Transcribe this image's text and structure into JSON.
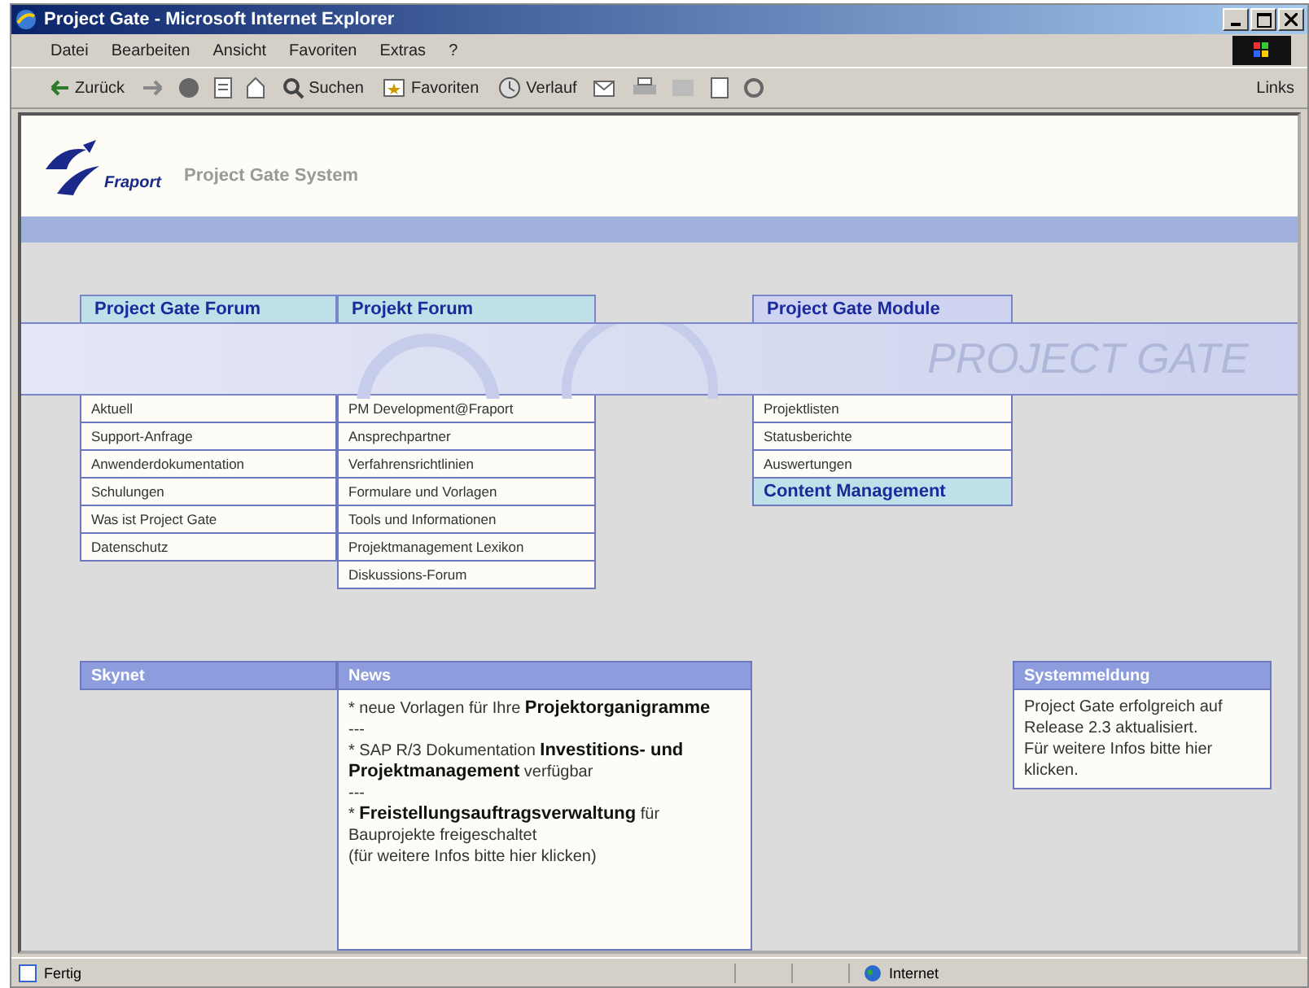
{
  "window": {
    "title": "Project Gate - Microsoft Internet Explorer"
  },
  "menu": [
    "Datei",
    "Bearbeiten",
    "Ansicht",
    "Favoriten",
    "Extras",
    "?"
  ],
  "toolbar": {
    "back": "Zurück",
    "search": "Suchen",
    "favorites": "Favoriten",
    "history": "Verlauf",
    "links": "Links"
  },
  "header": {
    "logo": "Fraport",
    "title": "Project Gate System"
  },
  "banner": "PROJECT GATE",
  "columns": [
    {
      "title": "Project Gate Forum",
      "items": [
        {
          "label": "Aktuell",
          "selected": false
        },
        {
          "label": "Support-Anfrage",
          "selected": false
        },
        {
          "label": "Anwenderdokumentation",
          "selected": false
        },
        {
          "label": "Schulungen",
          "selected": false
        },
        {
          "label": "Was ist Project Gate",
          "selected": false
        },
        {
          "label": "Datenschutz",
          "selected": false
        }
      ]
    },
    {
      "title": "Projekt Forum",
      "items": [
        {
          "label": "PM Development@Fraport",
          "selected": false
        },
        {
          "label": "Ansprechpartner",
          "selected": false
        },
        {
          "label": "Verfahrensrichtlinien",
          "selected": false
        },
        {
          "label": "Formulare und Vorlagen",
          "selected": false
        },
        {
          "label": "Tools und Informationen",
          "selected": false
        },
        {
          "label": "Projektmanagement Lexikon",
          "selected": false
        },
        {
          "label": "Diskussions-Forum",
          "selected": false
        }
      ]
    },
    {
      "title": "Project Gate Module",
      "items": [
        {
          "label": "Projektlisten",
          "selected": false
        },
        {
          "label": "Statusberichte",
          "selected": false
        },
        {
          "label": "Auswertungen",
          "selected": false
        },
        {
          "label": "Content Management",
          "selected": true
        }
      ]
    }
  ],
  "skynet": {
    "title": "Skynet"
  },
  "news": {
    "title": "News",
    "entries": [
      "* neue Vorlagen für Ihre **Projektorganigramme**",
      "---",
      "* SAP R/3 Dokumentation **Investitions- und Projektmanagement** verfügbar",
      "---",
      "* **Freistellungsauftragsverwaltung** für Bauprojekte freigeschaltet",
      "(für weitere Infos bitte hier klicken)"
    ]
  },
  "system": {
    "title": "Systemmeldung",
    "lines": [
      "Project Gate erfolgreich auf Release 2.3 aktualisiert.",
      "Für weitere Infos bitte hier klicken."
    ]
  },
  "status": {
    "text": "Fertig",
    "zone": "Internet"
  }
}
